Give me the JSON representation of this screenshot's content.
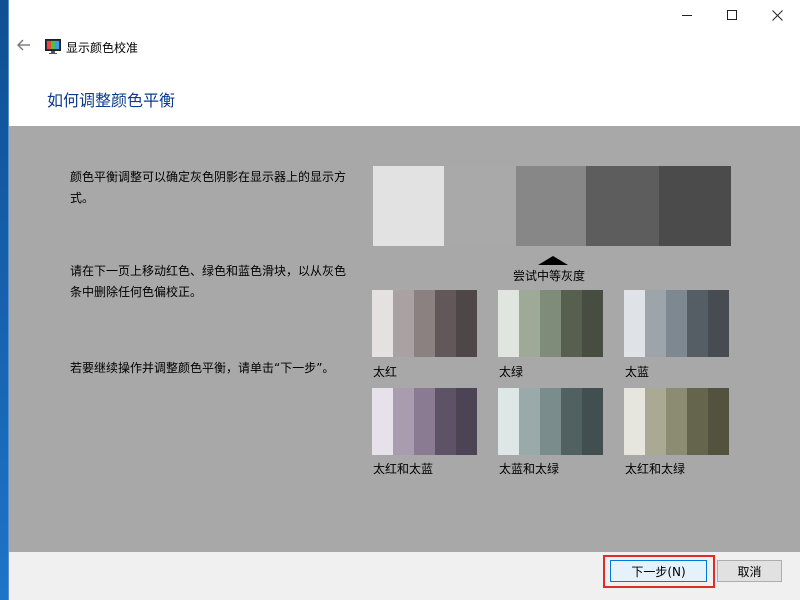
{
  "window": {
    "app_title": "显示颜色校准",
    "icons": {
      "back": "back-arrow-icon",
      "app": "display-calibration-icon",
      "minimize": "minimize-icon",
      "maximize": "maximize-icon",
      "close": "close-icon"
    }
  },
  "header": {
    "title": "如何调整颜色平衡"
  },
  "content": {
    "paragraph_1": "颜色平衡调整可以确定灰色阴影在显示器上的显示方式。",
    "paragraph_2": "请在下一页上移动红色、绿色和蓝色滑块，以从灰色条中删除任何色偏校正。",
    "paragraph_3": "若要继续操作并调整颜色平衡，请单击“下一步”。",
    "target_label": "尝试中等灰度",
    "main_strip": [
      "#e2e2e2",
      "#a9a9a9",
      "#878787",
      "#5d5d5d",
      "#4b4b4b"
    ],
    "examples": [
      {
        "label": "太红",
        "colors": [
          "#e6e1e1",
          "#aaa2a2",
          "#8b8181",
          "#625859",
          "#4f4747"
        ]
      },
      {
        "label": "太绿",
        "colors": [
          "#e0e6df",
          "#9ea998",
          "#7f8c79",
          "#57604f",
          "#474e41"
        ]
      },
      {
        "label": "太蓝",
        "colors": [
          "#dfe2e6",
          "#9da5aa",
          "#7e8890",
          "#565e65",
          "#464c52"
        ]
      },
      {
        "label": "太红和太蓝",
        "colors": [
          "#e6e1ea",
          "#a99caf",
          "#8a7b93",
          "#5d5266",
          "#4c4355"
        ]
      },
      {
        "label": "太蓝和太绿",
        "colors": [
          "#dfe6e6",
          "#9aa9a9",
          "#7b8c8d",
          "#516161",
          "#414f50"
        ]
      },
      {
        "label": "太红和太绿",
        "colors": [
          "#e6e6de",
          "#aaaa94",
          "#8c8c72",
          "#65654e",
          "#52523e"
        ]
      }
    ]
  },
  "footer": {
    "next_label": "下一步(N)",
    "cancel_label": "取消",
    "highlight_color": "#e32a2a"
  }
}
